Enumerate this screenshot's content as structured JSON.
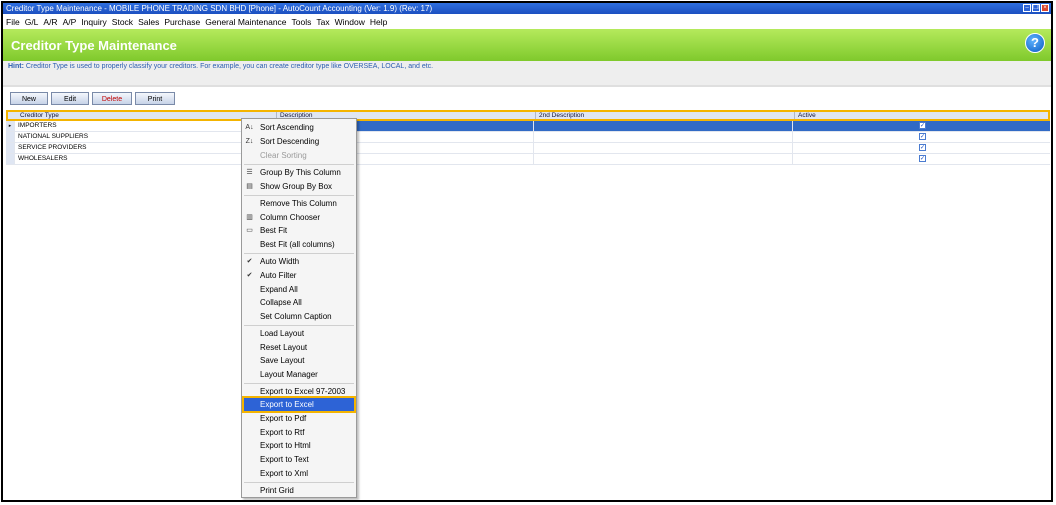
{
  "window": {
    "title": "Creditor Type Maintenance - MOBILE PHONE TRADING SDN BHD [Phone] - AutoCount Accounting (Ver: 1.9) (Rev: 17)"
  },
  "menubar": {
    "items": [
      "File",
      "G/L",
      "A/R",
      "A/P",
      "Inquiry",
      "Stock",
      "Sales",
      "Purchase",
      "General Maintenance",
      "Tools",
      "Tax",
      "Window",
      "Help"
    ]
  },
  "header": {
    "title": "Creditor Type Maintenance"
  },
  "hint": {
    "label": "Hint:",
    "text": "Creditor Type is used to properly classify your creditors. For example, you can create creditor type like OVERSEA, LOCAL, and etc."
  },
  "toolbar": {
    "new": "New",
    "edit": "Edit",
    "delete": "Delete",
    "print": "Print"
  },
  "grid": {
    "columns": [
      "Creditor Type",
      "Description",
      "2nd Description",
      "Active"
    ],
    "rows": [
      {
        "type": "IMPORTERS",
        "description": "",
        "desc2": "",
        "active": true
      },
      {
        "type": "NATIONAL SUPPLIERS",
        "description": "",
        "desc2": "",
        "active": true
      },
      {
        "type": "SERVICE PROVIDERS",
        "description": "",
        "desc2": "",
        "active": true
      },
      {
        "type": "WHOLESALERS",
        "description": "",
        "desc2": "",
        "active": true
      }
    ]
  },
  "context_menu": {
    "items": [
      {
        "label": "Sort Ascending",
        "icon": "sort-ascending-icon",
        "glyph": "A↓"
      },
      {
        "label": "Sort Descending",
        "icon": "sort-descending-icon",
        "glyph": "Z↓"
      },
      {
        "label": "Clear Sorting",
        "disabled": true
      },
      {
        "label": "Group By This Column",
        "icon": "group-by-icon",
        "glyph": "☰"
      },
      {
        "label": "Show Group By Box",
        "icon": "group-box-icon",
        "glyph": "▤"
      },
      {
        "label": "Remove This Column"
      },
      {
        "label": "Column Chooser",
        "icon": "column-chooser-icon",
        "glyph": "▥"
      },
      {
        "label": "Best Fit",
        "icon": "best-fit-icon",
        "glyph": "▭"
      },
      {
        "label": "Best Fit (all columns)"
      },
      {
        "label": "Auto Width",
        "checked": true
      },
      {
        "label": "Auto Filter",
        "checked": true
      },
      {
        "label": "Expand All"
      },
      {
        "label": "Collapse All"
      },
      {
        "label": "Set Column Caption"
      },
      {
        "label": "Load Layout"
      },
      {
        "label": "Reset Layout"
      },
      {
        "label": "Save Layout"
      },
      {
        "label": "Layout Manager"
      },
      {
        "label": "Export to Excel 97-2003"
      },
      {
        "label": "Export to Excel",
        "highlighted": true
      },
      {
        "label": "Export to Pdf"
      },
      {
        "label": "Export to Rtf"
      },
      {
        "label": "Export to Html"
      },
      {
        "label": "Export to Text"
      },
      {
        "label": "Export to Xml"
      },
      {
        "label": "Print Grid"
      }
    ]
  },
  "colors": {
    "accent_green": "#8fd33c",
    "selection": "#316ac5",
    "highlight_border": "#f4b400"
  }
}
